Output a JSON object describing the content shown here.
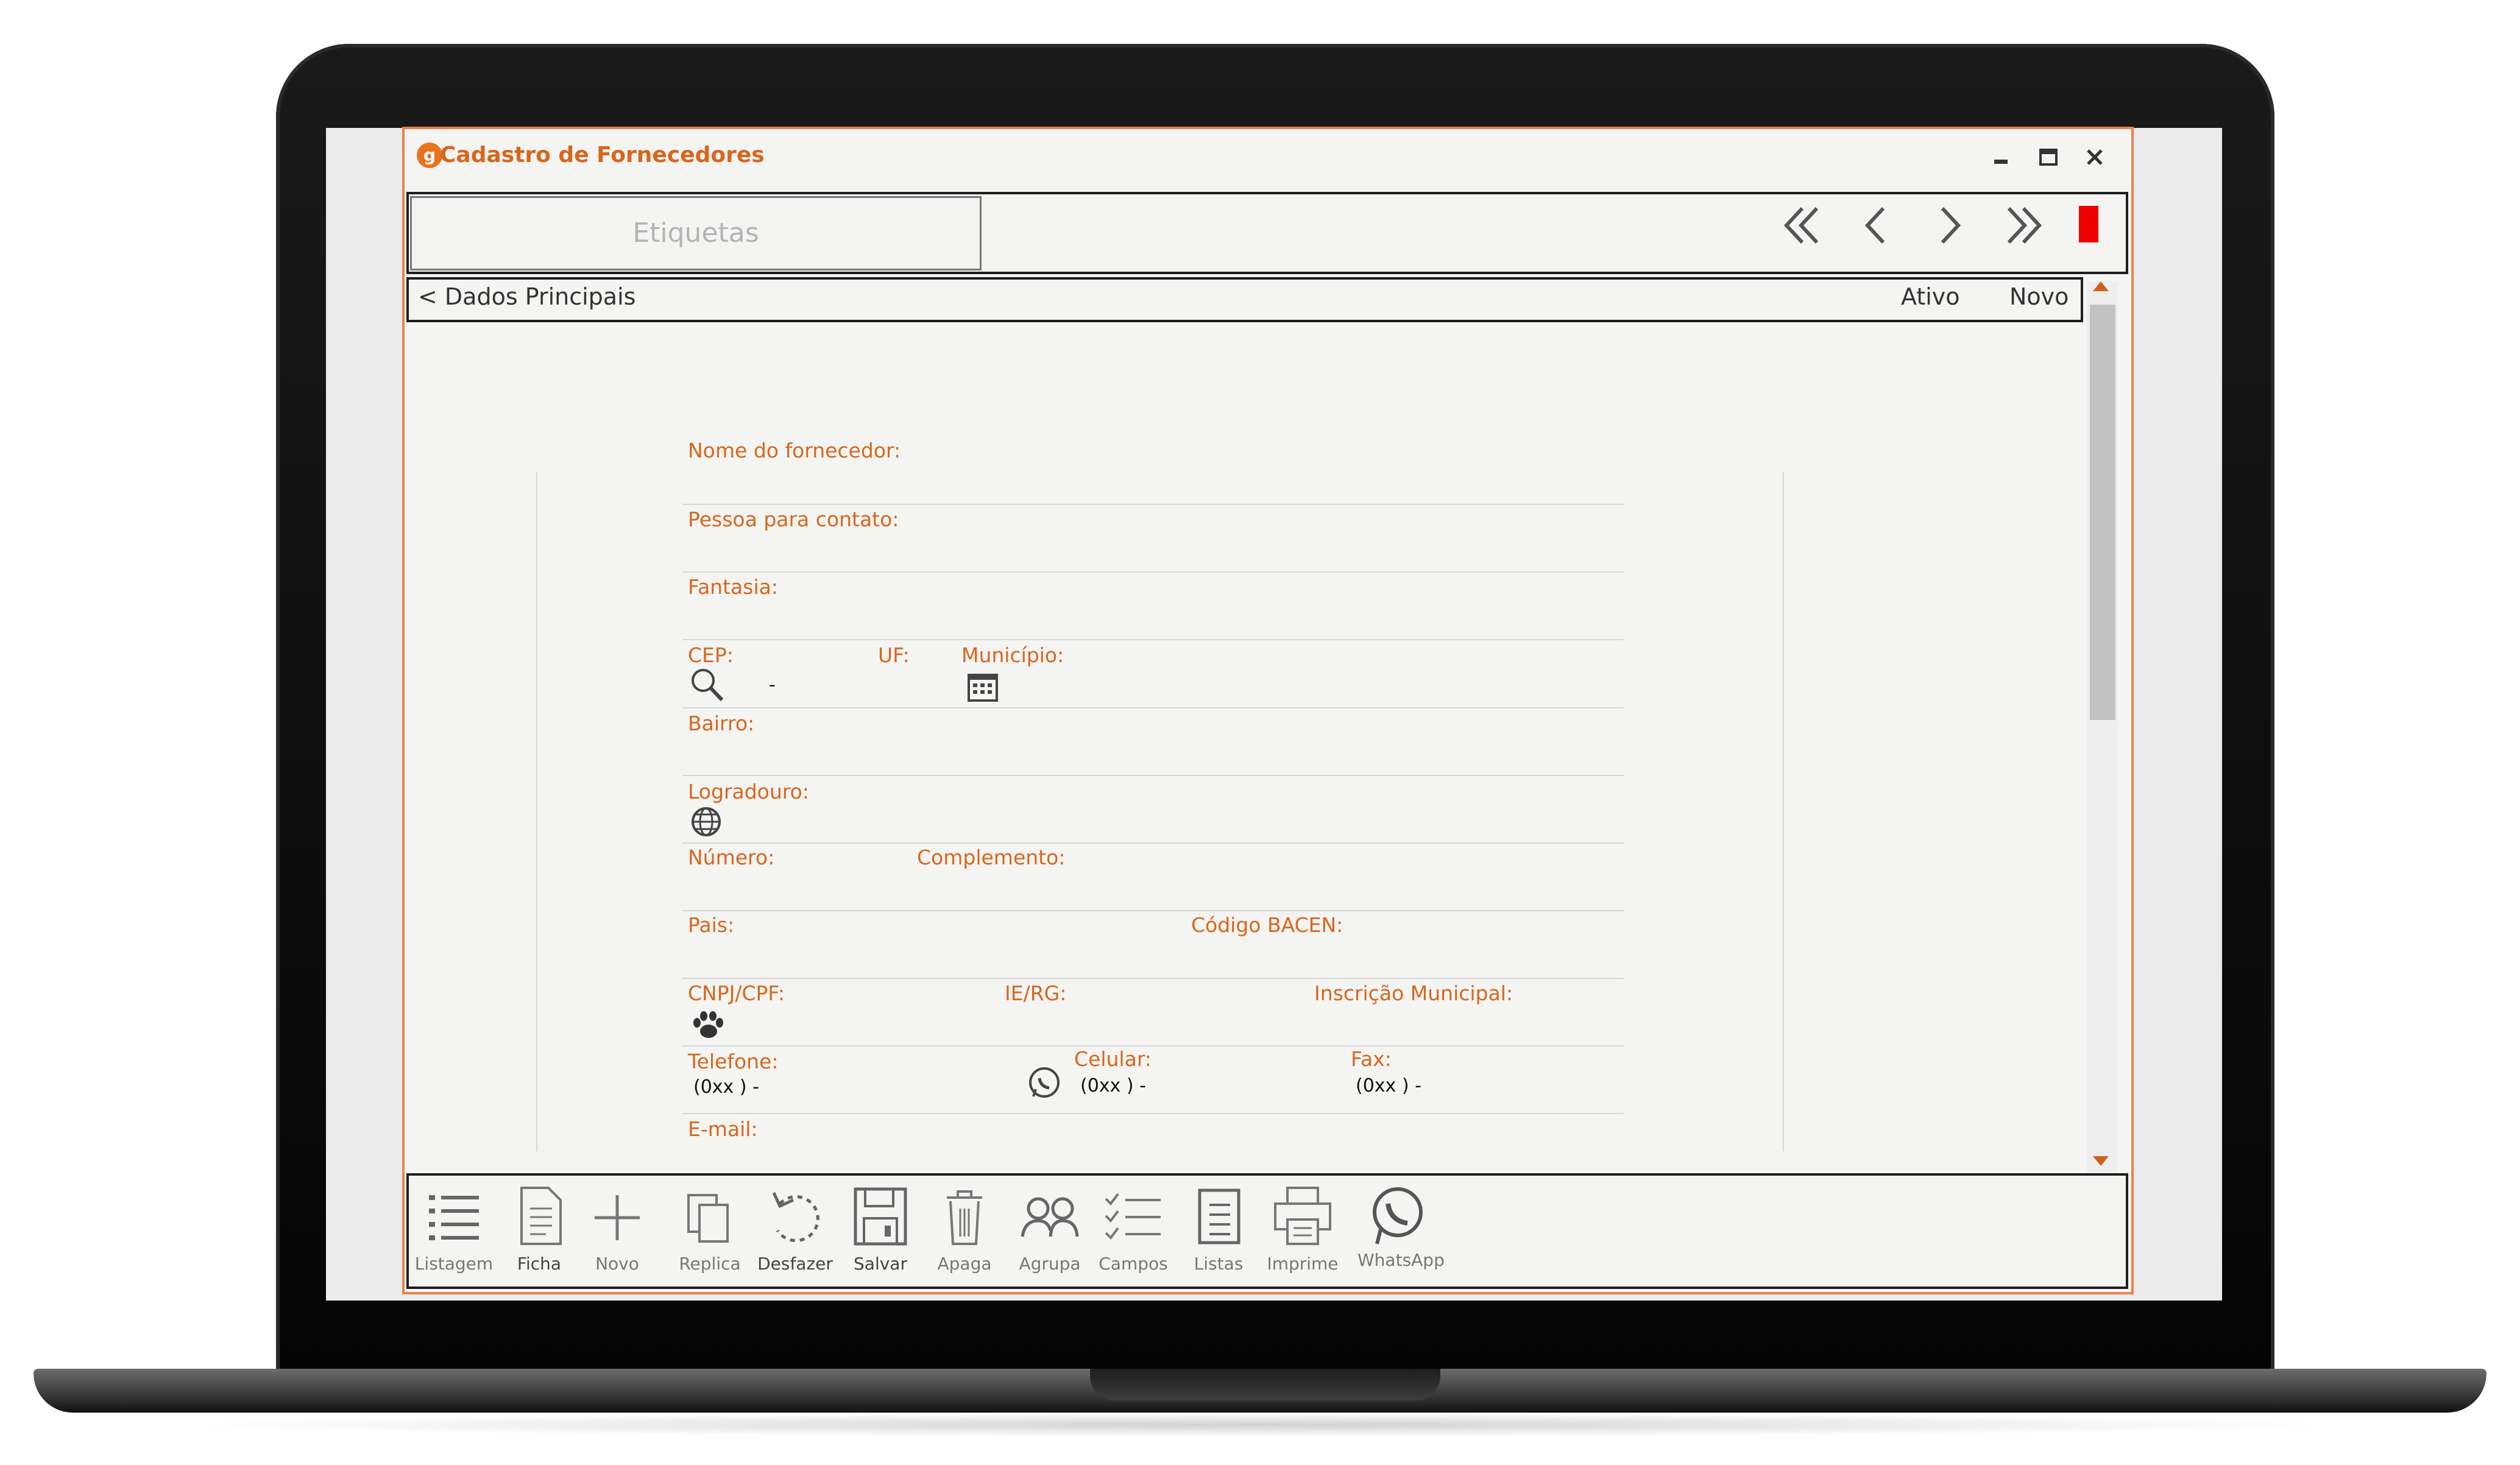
{
  "window": {
    "title": "Cadastro de Fornecedores",
    "app_icon": "g",
    "controls": [
      "minimize-icon",
      "maximize-icon",
      "close-icon"
    ]
  },
  "toolbar": {
    "etiquetas_placeholder": "Etiquetas",
    "nav_icons": [
      "first-record-icon",
      "previous-record-icon",
      "next-record-icon",
      "last-record-icon"
    ],
    "status_color": "#ef0000"
  },
  "section": {
    "back": "< Dados Principais",
    "status": "Ativo",
    "mode": "Novo"
  },
  "form": {
    "nome": "Nome do fornecedor:",
    "contato": "Pessoa para contato:",
    "fantasia": "Fantasia:",
    "cep": "CEP:",
    "cep_value": "-",
    "uf": "UF:",
    "municipio": "Município:",
    "bairro": "Bairro:",
    "logradouro": "Logradouro:",
    "numero": "Número:",
    "complemento": "Complemento:",
    "pais": "Pais:",
    "bacen": "Código BACEN:",
    "cnpj": "CNPJ/CPF:",
    "ie": "IE/RG:",
    "inscricao": "Inscrição Municipal:",
    "telefone": "Telefone:",
    "telefone_value": "(0xx )   -",
    "celular": "Celular:",
    "celular_value": "(0xx )   -",
    "fax": "Fax:",
    "fax_value": "(0xx )   -",
    "email": "E-mail:"
  },
  "bottom_toolbar": [
    {
      "label": "Listagem",
      "icon": "list-icon"
    },
    {
      "label": "Ficha",
      "icon": "document-icon"
    },
    {
      "label": "Novo",
      "icon": "plus-icon"
    },
    {
      "label": "Replica",
      "icon": "copy-icon"
    },
    {
      "label": "Desfazer",
      "icon": "undo-icon"
    },
    {
      "label": "Salvar",
      "icon": "save-icon"
    },
    {
      "label": "Apaga",
      "icon": "trash-icon"
    },
    {
      "label": "Agrupa",
      "icon": "group-icon"
    },
    {
      "label": "Campos",
      "icon": "checklist-icon"
    },
    {
      "label": "Listas",
      "icon": "list-doc-icon"
    },
    {
      "label": "Imprime",
      "icon": "printer-icon"
    },
    {
      "label": "WhatsApp",
      "icon": "whatsapp-icon"
    }
  ],
  "colors": {
    "accent": "#d9661d",
    "frame": "#e8834f"
  }
}
